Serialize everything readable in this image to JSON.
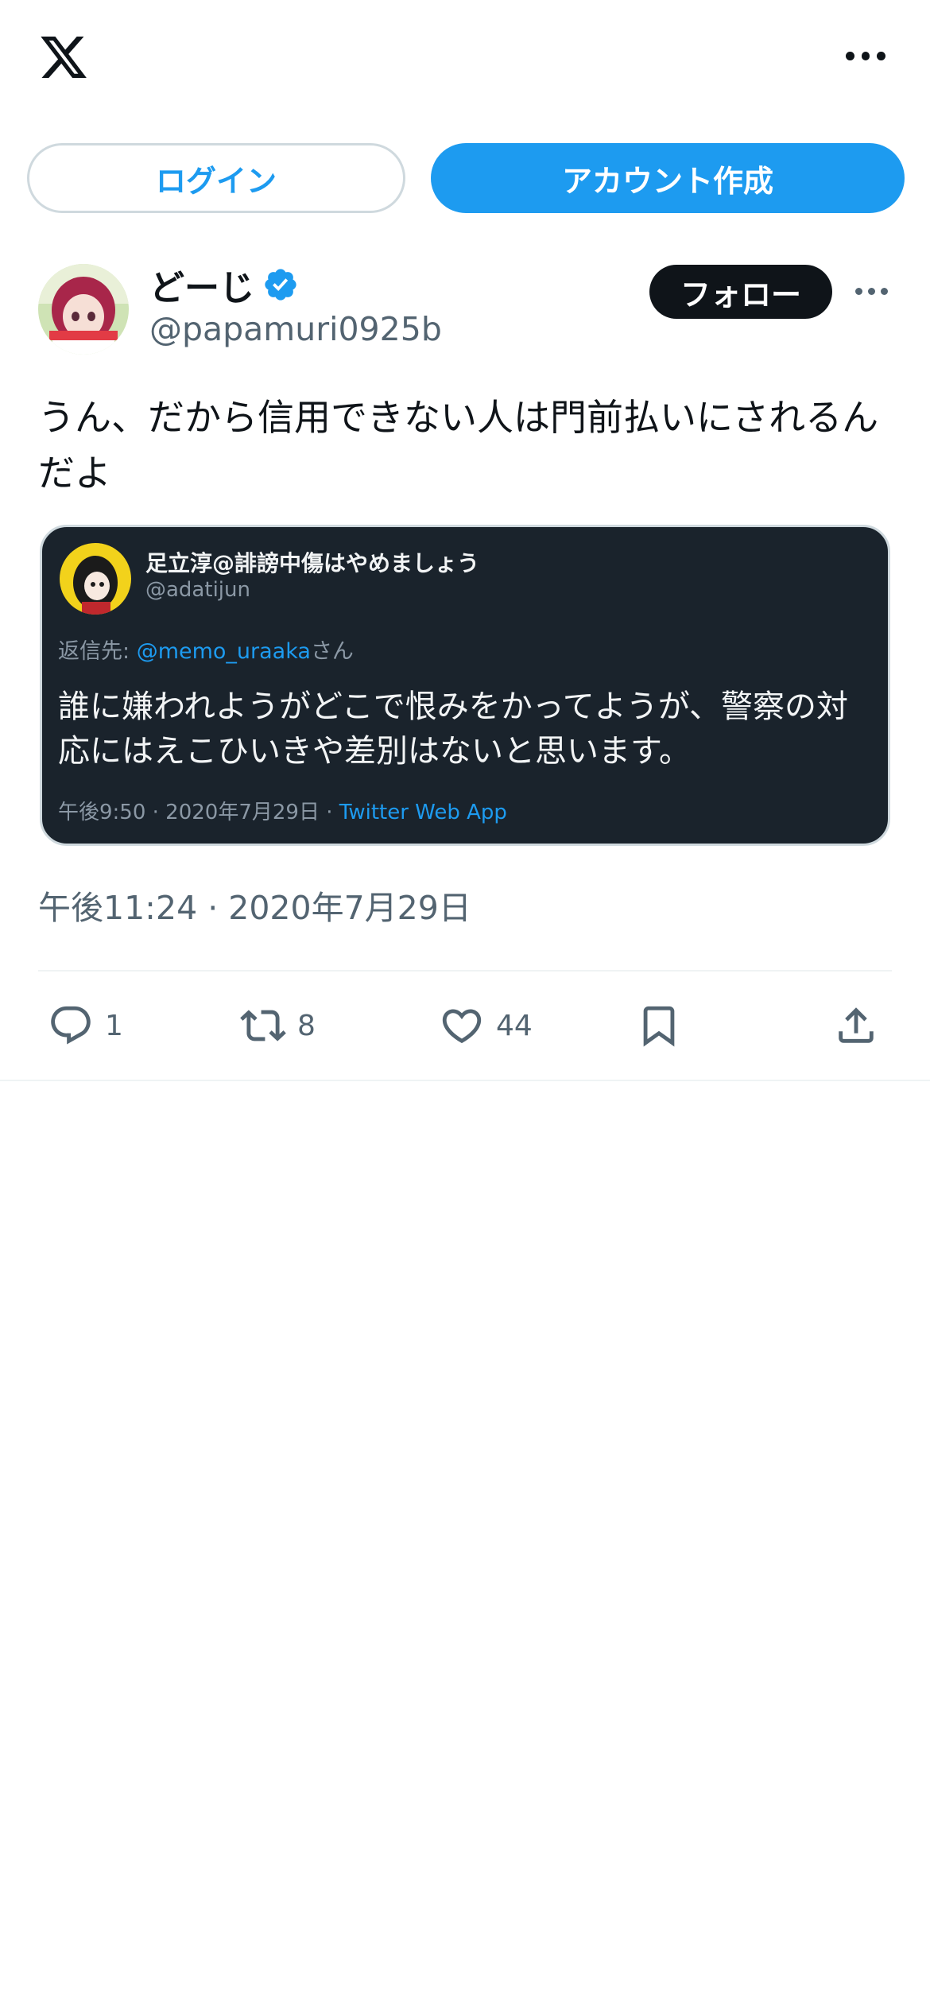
{
  "header": {
    "logo_icon": "x-logo-icon",
    "more_icon": "more-horizontal-icon"
  },
  "auth": {
    "login_label": "ログイン",
    "signup_label": "アカウント作成"
  },
  "post": {
    "author_name": "どーじ",
    "handle": "@papamuri0925b",
    "follow_label": "フォロー",
    "text": "うん、だから信用できない人は門前払いにされるんだよ",
    "timestamp": "午後11:24 · 2020年7月29日"
  },
  "quote": {
    "name": "足立淳@誹謗中傷はやめましょう",
    "handle": "@adatijun",
    "reply_prefix": "返信先: ",
    "reply_mention": "@memo_uraaka",
    "reply_suffix": "さん",
    "body": "誰に嫌われようがどこで恨みをかってようが、警察の対応にはえこひいきや差別はないと思います。",
    "meta": "午後9:50 · 2020年7月29日 · ",
    "app": "Twitter Web App"
  },
  "actions": {
    "replies": "1",
    "retweets": "8",
    "likes": "44"
  },
  "colors": {
    "accent": "#1d9bf0",
    "text": "#0f1419",
    "secondary": "#536471",
    "quote_bg": "#1a232c"
  }
}
